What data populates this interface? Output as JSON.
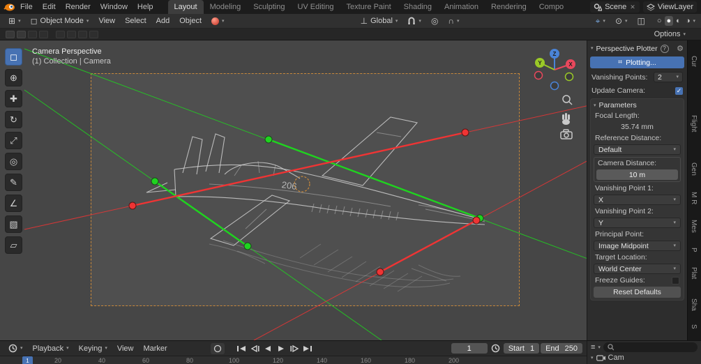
{
  "colors": {
    "accent": "#4772b3",
    "guide_green": "#1fd41f",
    "guide_red": "#ef3434",
    "camera_frame": "#c9893b",
    "axis_x": "#e8485c",
    "axis_y": "#9ac927",
    "axis_z": "#4a84d8"
  },
  "topbar": {
    "menus": [
      "File",
      "Edit",
      "Render",
      "Window",
      "Help"
    ],
    "workspaces": [
      "Layout",
      "Modeling",
      "Sculpting",
      "UV Editing",
      "Texture Paint",
      "Shading",
      "Animation",
      "Rendering",
      "Compo"
    ],
    "scene": "Scene",
    "view_layer": "ViewLayer"
  },
  "header": {
    "mode": "Object Mode",
    "menus": [
      "View",
      "Select",
      "Add",
      "Object"
    ],
    "orientation": "Global",
    "options": "Options"
  },
  "tools": [
    {
      "name": "select-box",
      "glyph": "◻"
    },
    {
      "name": "cursor",
      "glyph": "⊕"
    },
    {
      "name": "move",
      "glyph": "✚"
    },
    {
      "name": "rotate",
      "glyph": "↻"
    },
    {
      "name": "scale",
      "glyph": "⤢"
    },
    {
      "name": "transform",
      "glyph": "◎"
    },
    {
      "name": "annotate",
      "glyph": "✎"
    },
    {
      "name": "measure",
      "glyph": "∠"
    },
    {
      "name": "add-cube",
      "glyph": "▧"
    },
    {
      "name": "extrude",
      "glyph": "▱"
    }
  ],
  "viewport": {
    "view_label": "Camera Perspective",
    "context_label": "(1) Collection | Camera",
    "jet_marking": "206",
    "axes": {
      "x": "X",
      "y": "Y",
      "z": "Z"
    }
  },
  "plotter": {
    "title": "Perspective Plotter",
    "plotting": "Plotting...",
    "vanishing_points_label": "Vanishing Points:",
    "vanishing_points_value": "2",
    "update_camera": "Update Camera:",
    "parameters_title": "Parameters",
    "focal_length_label": "Focal Length:",
    "focal_length_value": "35.74 mm",
    "reference_distance_label": "Reference Distance:",
    "reference_distance_value": "Default",
    "camera_distance_label": "Camera Distance:",
    "camera_distance_value": "10 m",
    "vp1_label": "Vanishing Point 1:",
    "vp1_value": "X",
    "vp2_label": "Vanishing Point 2:",
    "vp2_value": "Y",
    "principal_label": "Principal Point:",
    "principal_value": "Image Midpoint",
    "target_label": "Target Location:",
    "target_value": "World Center",
    "freeze_label": "Freeze Guides:",
    "reset_button": "Reset Defaults"
  },
  "side_tabs": [
    "Cur",
    "Flight",
    "Gen",
    "M R",
    "Mes",
    "P",
    "Plat",
    "Sha",
    "S"
  ],
  "timeline": {
    "menus": [
      "Playback",
      "Keying",
      "View",
      "Marker"
    ],
    "current_frame": "1",
    "start_label": "Start",
    "start_value": "1",
    "end_label": "End",
    "end_value": "250",
    "playhead": "1",
    "ruler_ticks": [
      "20",
      "40",
      "60",
      "80",
      "100",
      "120",
      "140",
      "160",
      "180",
      "200"
    ]
  },
  "outliner": {
    "item": "Cam"
  }
}
